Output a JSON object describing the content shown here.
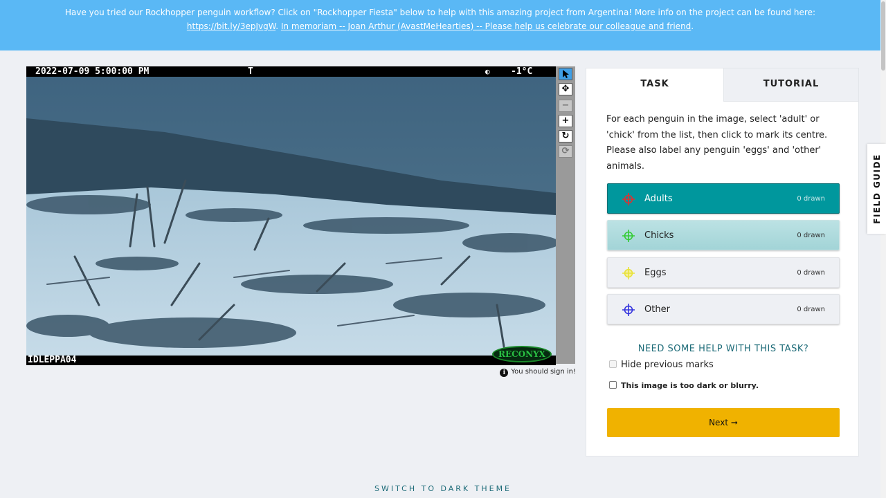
{
  "banner": {
    "text": "Have you tried our Rockhopper penguin workflow? Click on \"Rockhopper Fiesta\" below to help with this amazing project from Argentina! More info on the project can be found here:",
    "link1": "https://bit.ly/3epJvgW",
    "sep1": ". ",
    "link2": "In memoriam -- Joan Arthur (AvastMeHearties) -- Please help us celebrate our colleague and friend",
    "end": "."
  },
  "camera": {
    "datetime": "2022-07-09 5:00:00 PM",
    "flag": "T",
    "moon": "◐",
    "temperature": "-1°C",
    "camera_id": "IDLEPPA04",
    "brand": "RECONYX"
  },
  "viewer_tools": {
    "annotate_icon": "cursor-arrow-icon",
    "move_icon": "move-icon",
    "zoom_out_icon": "minus-icon",
    "zoom_in_icon": "plus-icon",
    "rotate_icon": "rotate-icon",
    "reset_icon": "reset-icon"
  },
  "signin_note": "You should sign in!",
  "tabs": {
    "task": "TASK",
    "tutorial": "TUTORIAL"
  },
  "task": {
    "instructions": "For each penguin in the image, select 'adult' or 'chick' from the list, then click to mark its centre. Please also label any penguin 'eggs' and 'other' animals.",
    "tools": [
      {
        "label": "Adults",
        "count": "0 drawn",
        "color": "#e03030"
      },
      {
        "label": "Chicks",
        "count": "0 drawn",
        "color": "#33cc33"
      },
      {
        "label": "Eggs",
        "count": "0 drawn",
        "color": "#e8e23a"
      },
      {
        "label": "Other",
        "count": "0 drawn",
        "color": "#3333dd"
      }
    ],
    "help": "NEED SOME HELP WITH THIS TASK?",
    "hide_marks": "Hide previous marks",
    "too_dark": "This image is too dark or blurry.",
    "next": "Next ➞"
  },
  "field_guide": "FIELD GUIDE",
  "theme_switch": "SWITCH TO DARK THEME"
}
